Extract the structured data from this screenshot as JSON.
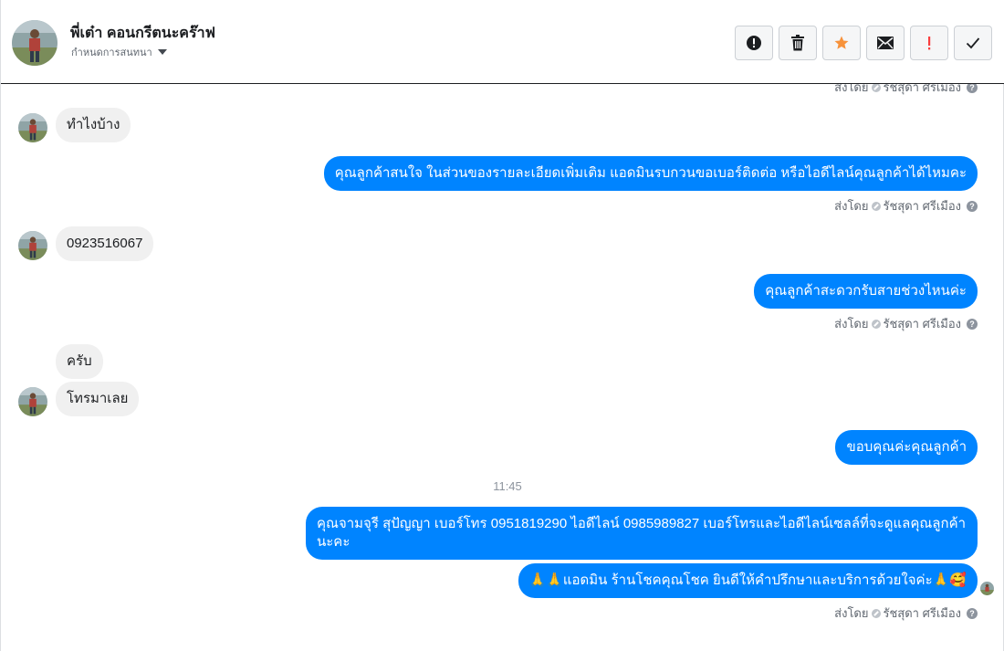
{
  "header": {
    "name": "พี่เต๋า คอนกรีตนะคร๊าฟ",
    "assign_label": "กำหนดการสนทนา"
  },
  "toolbar": {
    "buttons": [
      "spam-icon",
      "trash-icon",
      "star-icon",
      "mail-icon",
      "exclamation-icon",
      "check-icon"
    ],
    "star_color": "#f7923b",
    "alert_color": "#fa3e3e"
  },
  "sent_by": {
    "prefix": "ส่งโดย",
    "agent": "รัชสุดา ศรีเมือง",
    "help": "?"
  },
  "messages": {
    "m1": "ทำไงบ้าง",
    "m2": "คุณลูกค้าสนใจ ในส่วนของรายละเอียดเพิ่มเติม แอดมินรบกวนขอเบอร์ติดต่อ หรือไอดีไลน์คุณลูกค้าได้ไหมคะ",
    "m3": "0923516067",
    "m4": "คุณลูกค้าสะดวกรับสายช่วงไหนค่ะ",
    "m5": "ครับ",
    "m6": "โทรมาเลย",
    "m7": "ขอบคุณค่ะคุณลูกค้า",
    "time": "11:45",
    "m8": "คุณจามจุรี สุปัญญา เบอร์โทร 0951819290  ไอดีไลน์ 0985989827   เบอร์โทรและไอดีไลน์เซลล์ที่จะดูแลคุณลูกค้านะคะ",
    "m9_prefix": "🙏🙏",
    "m9": "แอดมิน ร้านโชคคุณโชค ยินดีให้คำปรึกษาและบริการด้วยใจค่ะ",
    "m9_suffix": "🙏🥰"
  },
  "colors": {
    "outgoing": "#0084ff",
    "incoming": "#f0f0f0"
  }
}
